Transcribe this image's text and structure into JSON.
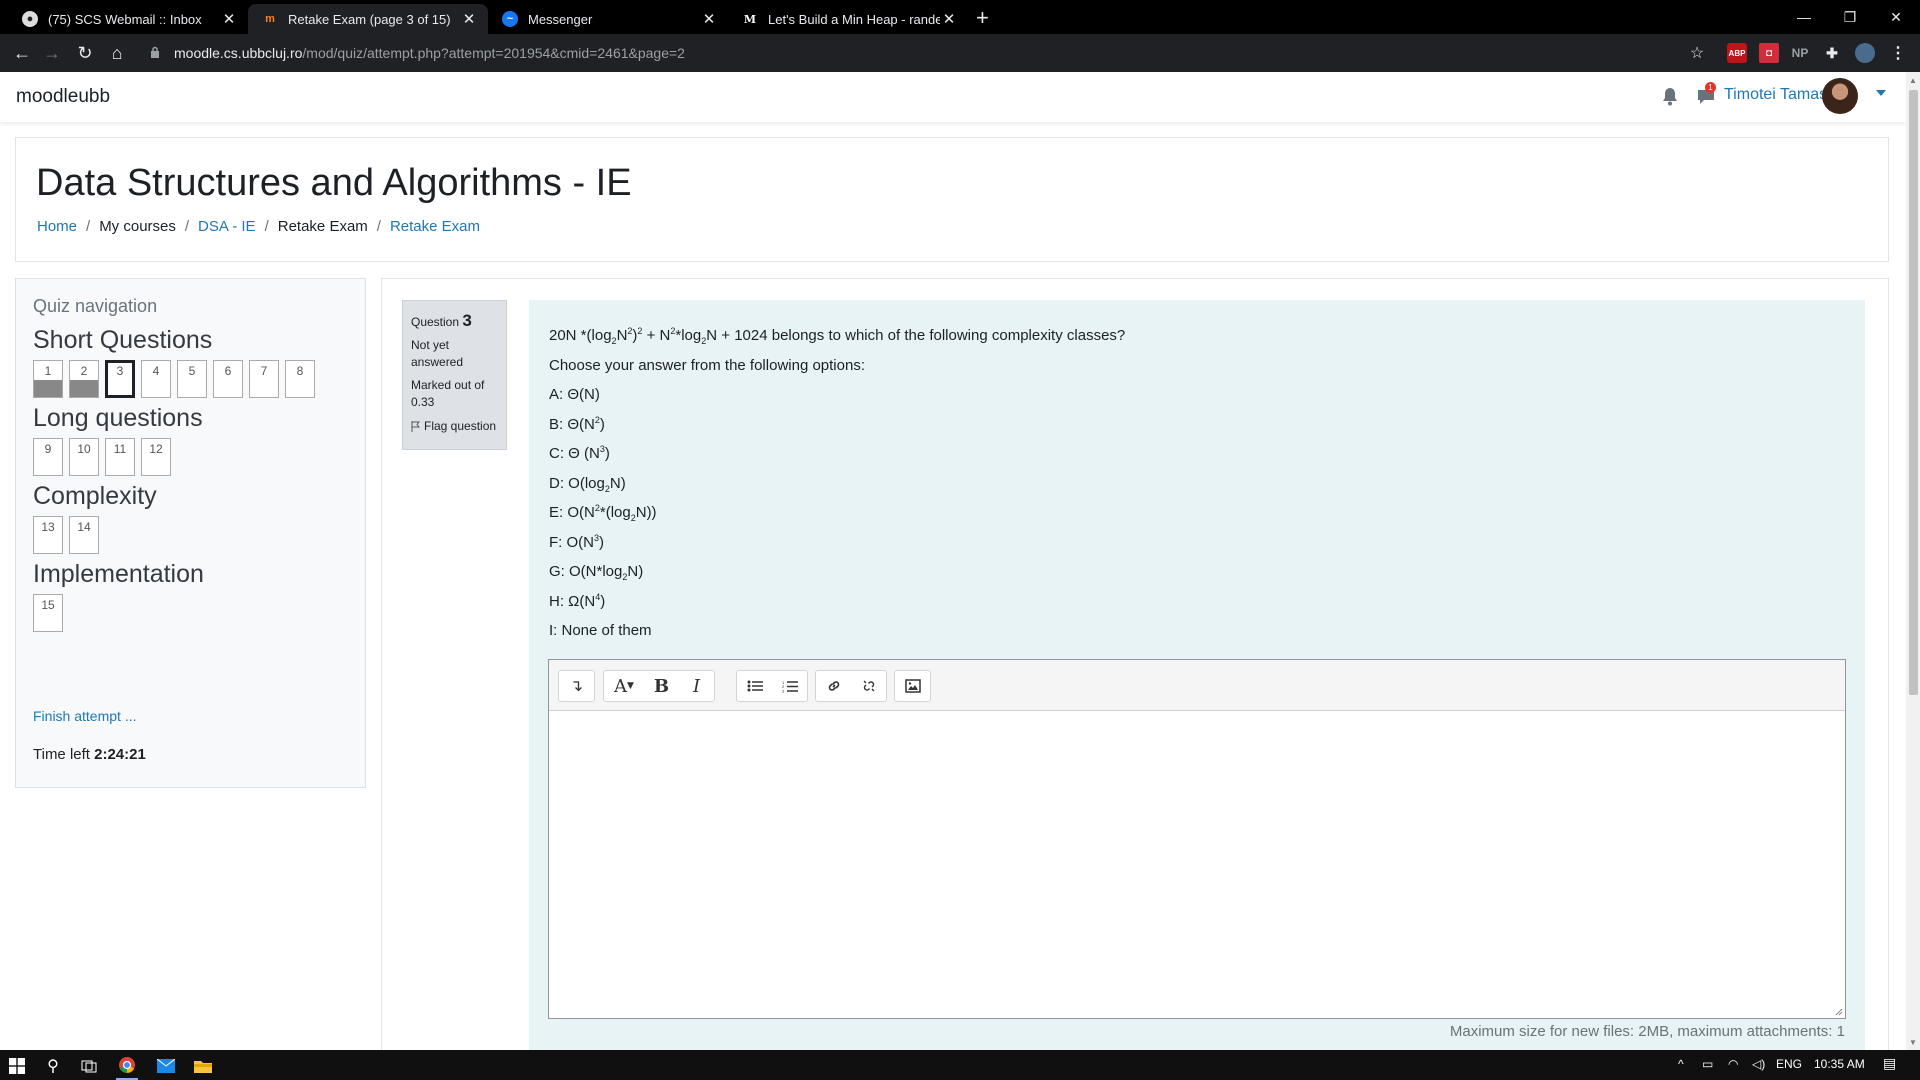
{
  "browser": {
    "tabs": [
      {
        "title": "(75) SCS Webmail :: Inbox",
        "active": false
      },
      {
        "title": "Retake Exam (page 3 of 15)",
        "active": true
      },
      {
        "title": "Messenger",
        "active": false
      },
      {
        "title": "Let's Build a Min Heap - randersc",
        "active": false
      }
    ],
    "url_host": "moodle.cs.ubbcluj.ro",
    "url_path": "/mod/quiz/attempt.php?attempt=201954&cmid=2461&page=2",
    "extensions": [
      "ABP",
      "NP"
    ]
  },
  "header": {
    "brand": "moodleubb",
    "user_name": "Timotei Tamas",
    "message_badge": "1"
  },
  "page": {
    "course_title": "Data Structures and Algorithms - IE",
    "breadcrumb": [
      {
        "label": "Home",
        "link": true
      },
      {
        "label": "My courses",
        "link": false
      },
      {
        "label": "DSA - IE",
        "link": true
      },
      {
        "label": "Retake Exam",
        "link": false
      },
      {
        "label": "Retake Exam",
        "link": true
      }
    ]
  },
  "quiz_nav": {
    "title": "Quiz navigation",
    "sections": [
      {
        "name": "Short Questions",
        "questions": [
          {
            "n": "1",
            "state": "answered"
          },
          {
            "n": "2",
            "state": "answered"
          },
          {
            "n": "3",
            "state": "current"
          },
          {
            "n": "4",
            "state": "open"
          },
          {
            "n": "5",
            "state": "open"
          },
          {
            "n": "6",
            "state": "open"
          },
          {
            "n": "7",
            "state": "open"
          },
          {
            "n": "8",
            "state": "open"
          }
        ]
      },
      {
        "name": "Long questions",
        "questions": [
          {
            "n": "9",
            "state": "open"
          },
          {
            "n": "10",
            "state": "open"
          },
          {
            "n": "11",
            "state": "open"
          },
          {
            "n": "12",
            "state": "open"
          }
        ]
      },
      {
        "name": "Complexity",
        "questions": [
          {
            "n": "13",
            "state": "open"
          },
          {
            "n": "14",
            "state": "open"
          }
        ]
      },
      {
        "name": "Implementation",
        "questions": [
          {
            "n": "15",
            "state": "open"
          }
        ]
      }
    ],
    "finish_link": "Finish attempt ...",
    "time_left_label": "Time left",
    "time_left_value": "2:24:21"
  },
  "question": {
    "label": "Question",
    "number": "3",
    "status": "Not yet answered",
    "marked": "Marked out of 0.33",
    "flag": "Flag question",
    "prompt_html": "20N *(log<sub>2</sub>N<sup>2</sup>)<sup>2</sup> + N<sup>2</sup>*log<sub>2</sub>N + 1024 belongs to which of the following complexity classes?",
    "instruction": "Choose your answer from the following options:",
    "options_html": [
      "A: Θ(N)",
      "B: Θ(N<sup>2</sup>)",
      "C: Θ (N<sup>3</sup>)",
      "D: O(log<sub>2</sub>N)",
      "E: O(N<sup>2</sup>*(log<sub>2</sub>N))",
      "F: O(N<sup>3</sup>)",
      "G: O(N*log<sub>2</sub>N)",
      "H: Ω(N<sup>4</sup>)",
      "I: None of them"
    ],
    "max_size_note": "Maximum size for new files: 2MB, maximum attachments: 1"
  },
  "taskbar": {
    "lang": "ENG",
    "time": "10:35 AM"
  },
  "colors": {
    "link": "#1f77b4",
    "formulation_bg": "#e7f3f5",
    "answered_fill": "#888888"
  }
}
